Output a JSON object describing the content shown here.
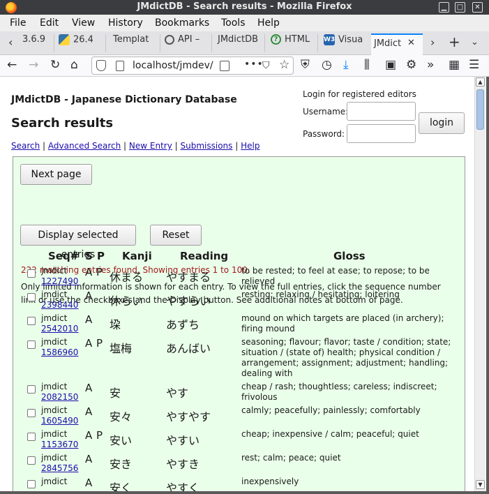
{
  "window": {
    "title": "JMdictDB - Search results - Mozilla Firefox"
  },
  "menu": [
    "File",
    "Edit",
    "View",
    "History",
    "Bookmarks",
    "Tools",
    "Help"
  ],
  "tabs": [
    "3.6.9",
    "26.4",
    "Templat",
    "API –",
    "JMdictDB",
    "HTML",
    "Visua",
    "JMdict"
  ],
  "url": "localhost/jmdev/",
  "page": {
    "site_title": "JMdictDB - Japanese Dictionary Database",
    "heading": "Search results",
    "links": [
      "Search",
      "Advanced Search",
      "New Entry",
      "Submissions",
      "Help"
    ],
    "link_sep": " | "
  },
  "login": {
    "title": "Login for registered editors",
    "username_label": "Username:",
    "password_label": "Password:",
    "button": "login"
  },
  "results": {
    "next_page": "Next page",
    "count_text": "222 matching entries found. Showing entries 1 to 100.",
    "info": "Only limited information is shown for each entry. To view the full entries, click the sequence number link or use the checkboxes and the Display button. See additional notes at bottom of page.",
    "display_button": "Display selected entries",
    "reset_button": "Reset",
    "headers": {
      "seq": "Seq#",
      "s": "S",
      "p": "P",
      "kanji": "Kanji",
      "reading": "Reading",
      "gloss": "Gloss"
    },
    "rows": [
      {
        "src": "jmdict",
        "seq": "1227490",
        "s": "A",
        "p": "P",
        "kanji": "休まる",
        "reading": "やすまる",
        "gloss": "to be rested; to feel at ease; to repose; to be relieved"
      },
      {
        "src": "jmdict",
        "seq": "2398440",
        "s": "A",
        "p": "",
        "kanji": "休らい",
        "reading": "やすらい",
        "gloss": "resting; relaxing / hesitating; loitering"
      },
      {
        "src": "jmdict",
        "seq": "2542010",
        "s": "A",
        "p": "",
        "kanji": "垜",
        "reading": "あずち",
        "gloss": "mound on which targets are placed (in archery); firing mound"
      },
      {
        "src": "jmdict",
        "seq": "1586960",
        "s": "A",
        "p": "P",
        "kanji": "塩梅",
        "reading": "あんばい",
        "gloss": "seasoning; flavour; flavor; taste / condition; state; situation / (state of) health; physical condition / arrangement; assignment; adjustment; handling; dealing with"
      },
      {
        "src": "jmdict",
        "seq": "2082150",
        "s": "A",
        "p": "",
        "kanji": "安",
        "reading": "やす",
        "gloss": "cheap / rash; thoughtless; careless; indiscreet; frivolous"
      },
      {
        "src": "jmdict",
        "seq": "1605490",
        "s": "A",
        "p": "",
        "kanji": "安々",
        "reading": "やすやす",
        "gloss": "calmly; peacefully; painlessly; comfortably"
      },
      {
        "src": "jmdict",
        "seq": "1153670",
        "s": "A",
        "p": "P",
        "kanji": "安い",
        "reading": "やすい",
        "gloss": "cheap; inexpensive / calm; peaceful; quiet"
      },
      {
        "src": "jmdict",
        "seq": "2845756",
        "s": "A",
        "p": "",
        "kanji": "安き",
        "reading": "やすき",
        "gloss": "rest; calm; peace; quiet"
      },
      {
        "src": "jmdict",
        "seq": "",
        "s": "A",
        "p": "",
        "kanji": "安く",
        "reading": "やすく",
        "gloss": "inexpensively"
      }
    ]
  }
}
